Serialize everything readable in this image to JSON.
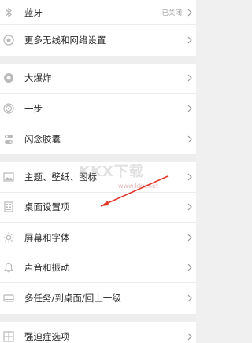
{
  "groups": [
    {
      "items": [
        {
          "icon": "bluetooth-icon",
          "label": "蓝牙",
          "value": "已关闭"
        },
        {
          "icon": "network-settings-icon",
          "label": "更多无线和网络设置"
        }
      ]
    },
    {
      "items": [
        {
          "icon": "big-bang-icon",
          "label": "大爆炸"
        },
        {
          "icon": "one-step-icon",
          "label": "一步"
        },
        {
          "icon": "idea-capsule-icon",
          "label": "闪念胶囊"
        }
      ]
    },
    {
      "items": [
        {
          "icon": "theme-icon",
          "label": "主题、壁纸、图标"
        },
        {
          "icon": "desktop-settings-icon",
          "label": "桌面设置项"
        },
        {
          "icon": "brightness-icon",
          "label": "屏幕和字体"
        },
        {
          "icon": "bell-icon",
          "label": "声音和振动"
        },
        {
          "icon": "multitask-icon",
          "label": "多任务/到桌面/回上一级"
        }
      ]
    },
    {
      "items": [
        {
          "icon": "compulsive-options-icon",
          "label": "强迫症选项"
        }
      ]
    }
  ],
  "watermark": {
    "text": "KKX下载",
    "url": "www.kkx.net"
  },
  "colors": {
    "annotation_arrow": "#e0392b",
    "icon": "#b9b9b9",
    "chevron": "#9a9a9a"
  }
}
